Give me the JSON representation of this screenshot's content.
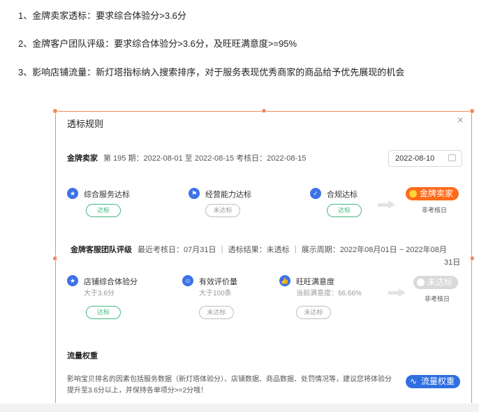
{
  "intro": [
    "1、金牌卖家透标：要求综合体验分>3.6分",
    "2、金牌客户团队评级：要求综合体验分>3.6分，及旺旺满意度>=95%",
    "3、影响店铺流量：新灯塔指标纳入搜索排序，对于服务表现优秀商家的商品给予优先展现的机会"
  ],
  "modal": {
    "title": "透标规则",
    "close": "×"
  },
  "gold_seller": {
    "label": "金牌卖家",
    "period": "第 195 期：2022-08-01 至 2022-08-15 考核日：2022-08-15",
    "date": "2022-08-10",
    "metrics": [
      {
        "icon": "★",
        "label": "综合服务达标",
        "status": "达标"
      },
      {
        "icon": "⚑",
        "label": "经营能力达标",
        "status": "未达标"
      },
      {
        "icon": "✓",
        "label": "合规达标",
        "status": "达标"
      }
    ],
    "badge": "金牌卖家",
    "badge_note": "非考核日"
  },
  "service_team": {
    "label": "金牌客服团队评级",
    "info_line1": "最近考核日：07月31日 ｜ 透标结果：未透标 ｜ 展示周期：2022年08月01日 ~ 2022年08月",
    "info_line2": "31日",
    "metrics": [
      {
        "icon": "★",
        "label": "店铺综合体验分",
        "sub": "大于3.6分",
        "status": "达标"
      },
      {
        "icon": "☺",
        "label": "有效评价量",
        "sub": "大于100条",
        "status": "未达标"
      },
      {
        "icon": "👍",
        "label": "旺旺满意度",
        "sub": "当前满意度：66.66%",
        "status": "未达标"
      }
    ],
    "badge": "未达标",
    "badge_note": "非考核日"
  },
  "traffic": {
    "title": "流量权重",
    "desc": "影响宝贝排名的因素包括服务数据（新灯塔体验分）、店铺数据、商品数据、处罚情况等，建议您将体验分提升至3.6分以上，并保持各单项分>=2分哦！",
    "badge": "流量权重"
  },
  "colors": {
    "frame": "#f08a5d",
    "accent_blue": "#3d72e8",
    "pass_green": "#41b883",
    "gold_orange": "#ff6a1a"
  }
}
